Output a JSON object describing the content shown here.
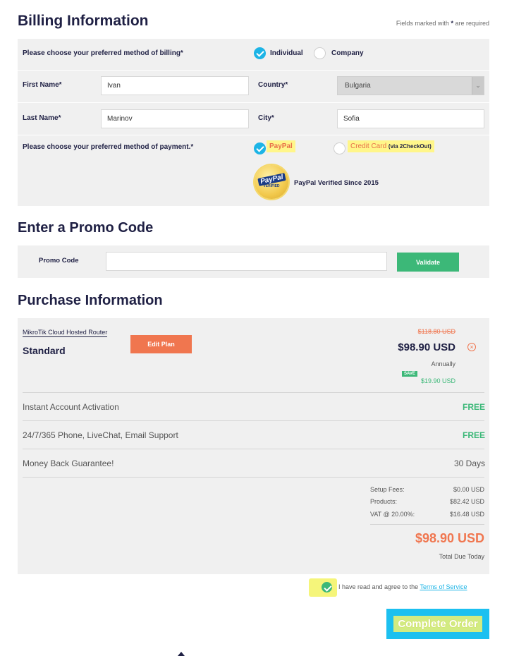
{
  "billing": {
    "title": "Billing Information",
    "required_note_pre": "Fields marked with",
    "required_note_star": "*",
    "required_note_post": "are required",
    "method_label": "Please choose your preferred method of billing*",
    "option_individual": "Individual",
    "option_company": "Company",
    "first_name_label": "First Name*",
    "first_name_value": "Ivan",
    "country_label": "Country*",
    "country_value": "Bulgaria",
    "last_name_label": "Last Name*",
    "last_name_value": "Marinov",
    "city_label": "City*",
    "city_value": "Sofia",
    "payment_label": "Please choose your preferred method of payment.*",
    "payment_paypal": "PayPal",
    "payment_card": "Credit Card",
    "payment_card_note": "(via 2CheckOut)",
    "paypal_badge_text": "PayPal",
    "paypal_badge_sub": "VERIFIED",
    "paypal_verified": "PayPal Verified Since 2015"
  },
  "promo": {
    "title": "Enter a Promo Code",
    "label": "Promo Code",
    "value": "",
    "validate_label": "Validate"
  },
  "purchase": {
    "title": "Purchase Information",
    "product_name": "MikroTik Cloud Hosted Router",
    "plan": "Standard",
    "edit_plan_label": "Edit Plan",
    "old_price": "$118.80 USD",
    "price": "$98.90 USD",
    "period": "Annually",
    "save_badge": "SAVE",
    "save_amount": "$19.90 USD",
    "features": [
      {
        "name": "Instant Account Activation",
        "value": "FREE"
      },
      {
        "name": "24/7/365 Phone, LiveChat, Email Support",
        "value": "FREE"
      },
      {
        "name": "Money Back Guarantee!",
        "value": "30 Days"
      }
    ],
    "summary": [
      {
        "label": "Setup Fees:",
        "value": "$0.00 USD"
      },
      {
        "label": "Products:",
        "value": "$82.42 USD"
      },
      {
        "label": "VAT @ 20.00%:",
        "value": "$16.48 USD"
      }
    ],
    "total": "$98.90 USD",
    "total_label": "Total Due Today"
  },
  "terms": {
    "text": "I have read and agree to the",
    "link": "Terms of Service"
  },
  "complete_label": "Complete Order",
  "colors": {
    "accent_blue": "#1cb4e6",
    "green": "#3cb878",
    "orange": "#f0764f",
    "highlight": "#fff68a"
  }
}
